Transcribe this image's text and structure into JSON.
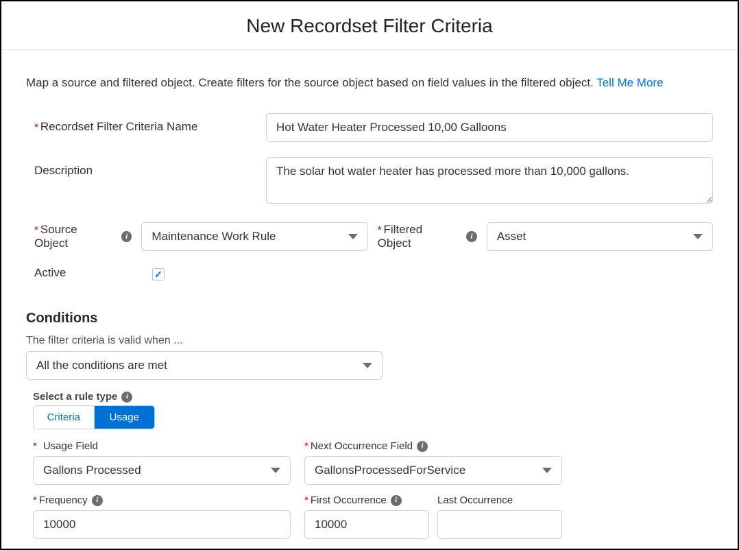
{
  "title": "New Recordset Filter Criteria",
  "intro_text": "Map a source and filtered object. Create filters for the source object based on field values in the filtered object. ",
  "intro_link": "Tell Me More",
  "labels": {
    "name": "Recordset Filter Criteria Name",
    "description": "Description",
    "source_object": "Source Object",
    "filtered_object": "Filtered Object",
    "active": "Active"
  },
  "values": {
    "name": "Hot Water Heater Processed 10,00 Galloons",
    "description": "The solar hot water heater has processed more than 10,000 gallons.",
    "source_object": "Maintenance Work Rule",
    "filtered_object": "Asset",
    "active_checked": true
  },
  "conditions": {
    "heading": "Conditions",
    "subtext": "The filter criteria is valid when ...",
    "logic_value": "All the conditions are met",
    "rule_type_label": "Select a rule type",
    "tabs": {
      "criteria": "Criteria",
      "usage": "Usage"
    },
    "active_tab": "usage",
    "usage": {
      "usage_field_label": "Usage Field",
      "usage_field_value": "Gallons Processed",
      "next_occ_label": "Next Occurrence Field",
      "next_occ_value": "GallonsProcessedForService",
      "frequency_label": "Frequency",
      "frequency_value": "10000",
      "first_occ_label": "First Occurrence",
      "first_occ_value": "10000",
      "last_occ_label": "Last Occurrence",
      "last_occ_value": ""
    }
  }
}
